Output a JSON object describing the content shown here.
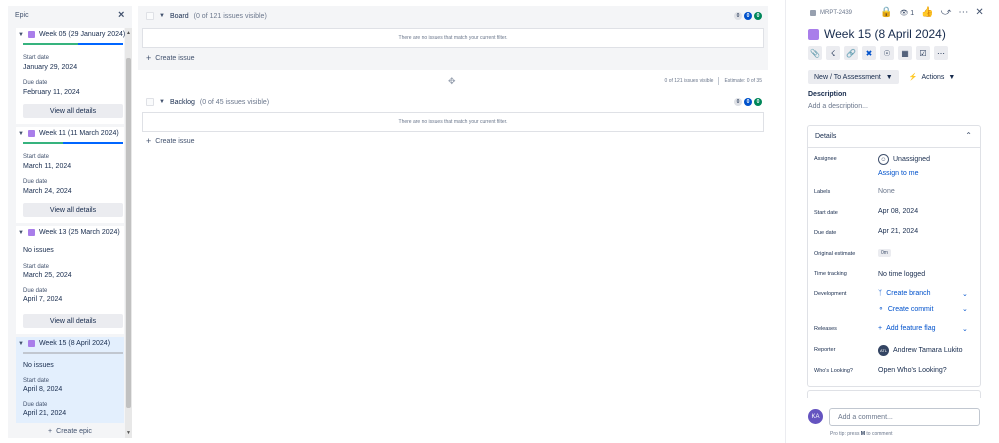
{
  "epic_panel": {
    "title": "Epic",
    "close_icon": "×",
    "create_epic": "Create epic",
    "epics": [
      {
        "name": "Week 05 (29 January 2024)",
        "progress": {
          "done": 0.55,
          "in_progress": 0.0,
          "todo": 0.45
        },
        "start_label": "Start date",
        "start": "January 29, 2024",
        "due_label": "Due date",
        "due": "February 11, 2024",
        "button": "View all details"
      },
      {
        "name": "Week 11 (11 March 2024)",
        "progress": {
          "done": 0.4,
          "in_progress": 0.0,
          "todo": 0.6
        },
        "start_label": "Start date",
        "start": "March 11, 2024",
        "due_label": "Due date",
        "due": "March 24, 2024",
        "button": "View all details"
      },
      {
        "name": "Week 13 (25 March 2024)",
        "no_issues": "No issues",
        "start_label": "Start date",
        "start": "March 25, 2024",
        "due_label": "Due date",
        "due": "April 7, 2024",
        "button": "View all details"
      },
      {
        "name": "Week 15 (8 April 2024)",
        "no_issues": "No issues",
        "start_label": "Start date",
        "start": "April 8, 2024",
        "due_label": "Due date",
        "due": "April 21, 2024"
      }
    ]
  },
  "board": {
    "name": "Board",
    "count": "(0 of 121 issues visible)",
    "empty": "There are no issues that match your current filter.",
    "create": "Create issue",
    "badges": [
      "0",
      "0",
      "0"
    ],
    "summary_issues": "0 of 121 issues visible",
    "summary_estimate": "Estimate: 0 of 35"
  },
  "backlog": {
    "name": "Backlog",
    "count": "(0 of 45 issues visible)",
    "empty": "There are no issues that match your current filter.",
    "create": "Create issue",
    "badges": [
      "0",
      "0",
      "0"
    ]
  },
  "issue": {
    "key": "MRPT-2439",
    "watch_count": "1",
    "title": "Week 15 (8 April 2024)",
    "status": "New / To Assessment",
    "actions": "Actions",
    "description_label": "Description",
    "description_placeholder": "Add a description...",
    "details": {
      "title": "Details",
      "assignee_label": "Assignee",
      "assignee": "Unassigned",
      "assign_to_me": "Assign to me",
      "labels_label": "Labels",
      "labels": "None",
      "start_label": "Start date",
      "start": "Apr 08, 2024",
      "due_label": "Due date",
      "due": "Apr 21, 2024",
      "orig_label": "Original estimate",
      "orig": "0m",
      "time_label": "Time tracking",
      "time": "No time logged",
      "dev_label": "Development",
      "create_branch": "Create branch",
      "create_commit": "Create commit",
      "releases_label": "Releases",
      "add_flag": "Add feature flag",
      "reporter_label": "Reporter",
      "reporter": "Andrew Tamara Lukito",
      "reporter_initials": "ATL",
      "wl_label": "Who's Looking?",
      "wl_value": "Open Who's Looking?"
    },
    "comment": {
      "avatar": "KA",
      "placeholder": "Add a comment...",
      "tip_prefix": "Pro tip: press",
      "tip_key": "M",
      "tip_suffix": "to comment"
    }
  },
  "colors": {
    "epic": "#a97eea",
    "done": "#36b37e",
    "todo": "#0065ff",
    "link": "#0052cc"
  }
}
